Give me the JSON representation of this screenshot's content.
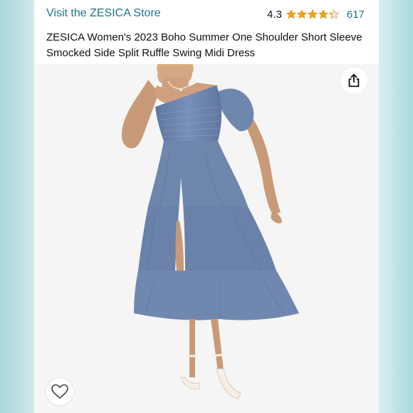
{
  "store": {
    "link_text": "Visit the ZESICA Store"
  },
  "rating": {
    "value": "4.3",
    "stars": 4.3,
    "max_stars": 5,
    "count": "617"
  },
  "product": {
    "title": "ZESICA Women's 2023 Boho Summer One Shoulder Short Sleeve Smocked Side Split Ruffle Swing Midi Dress"
  },
  "colors": {
    "link": "#1f7489",
    "star": "#f0a215",
    "star_empty": "#e8e8e8",
    "dress": "#6f86ad",
    "image_bg": "#f5f5f5"
  },
  "icons": {
    "share": "share-icon",
    "favorite": "heart-outline-icon",
    "star": "star-icon"
  }
}
